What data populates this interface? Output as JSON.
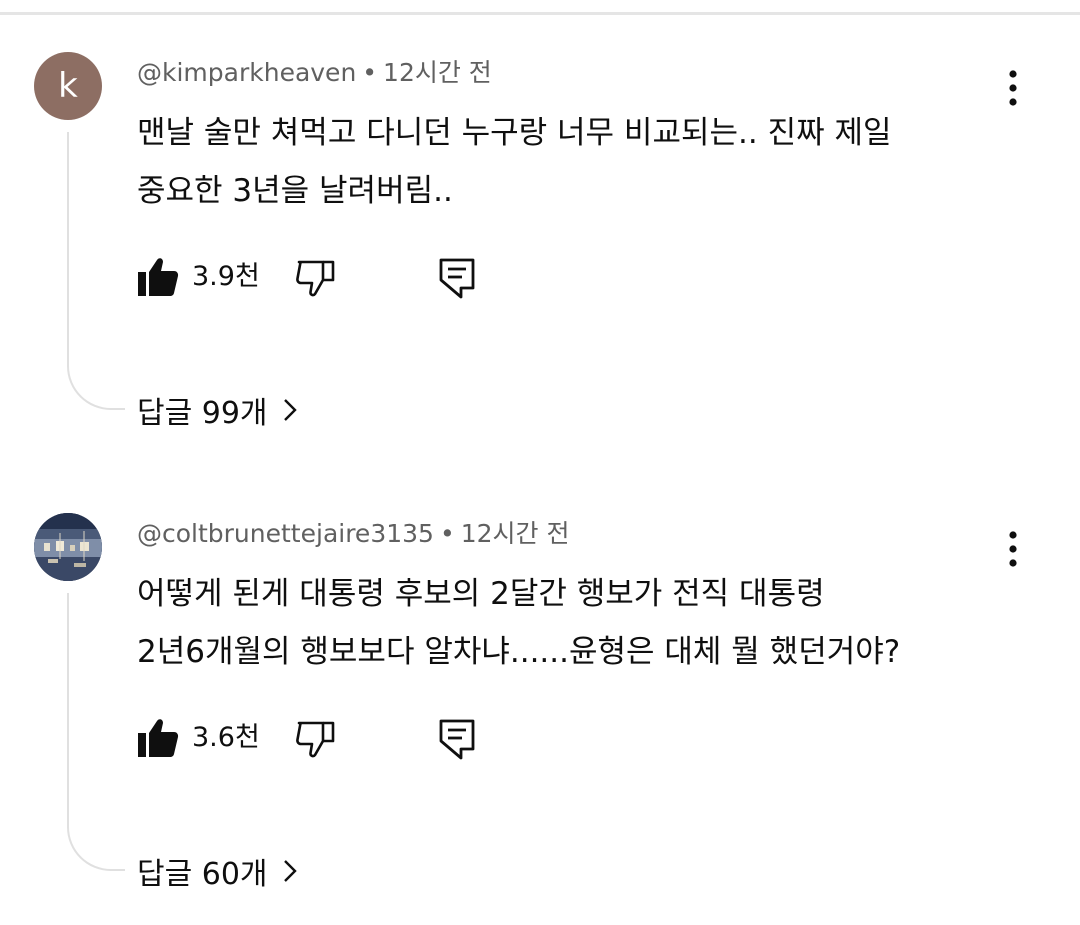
{
  "comments": [
    {
      "author": "@kimparkheaven",
      "separator": "•",
      "time": "12시간 전",
      "avatar_letter": "k",
      "avatar_color": "#8d6e63",
      "text_line1": "맨날 술만 쳐먹고 다니던 누구랑 너무 비교되는.. 진짜 제일",
      "text_line2": "중요한 3년을 날려버림..",
      "like_count": "3.9천",
      "replies_label": "답글 99개"
    },
    {
      "author": "@coltbrunettejaire3135",
      "separator": "•",
      "time": "12시간 전",
      "text_line1": "어떻게 된게 대통령 후보의 2달간 행보가 전직 대통령",
      "text_line2": "2년6개월의 행보보다 알차냐......윤형은 대체 뭘 했던거야?",
      "like_count": "3.6천",
      "replies_label": "답글 60개"
    }
  ],
  "icons": {
    "like": "thumbs-up-filled-icon",
    "dislike": "thumbs-down-outline-icon",
    "reply": "comment-reply-icon",
    "more": "more-vertical-icon",
    "chevron": "chevron-right-icon"
  },
  "colors": {
    "text": "#0f0f0f",
    "meta": "#606060",
    "thread_line": "#e0e0e0"
  }
}
